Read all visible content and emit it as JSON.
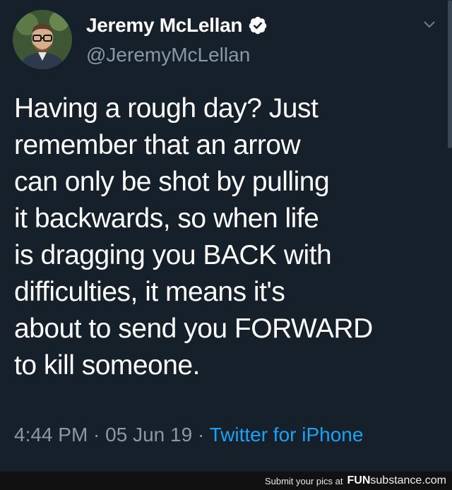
{
  "tweet": {
    "display_name": "Jeremy McLellan",
    "handle": "@JeremyMcLellan",
    "verified": true,
    "text": "Having a rough day? Just\nremember that an arrow\ncan only be shot by pulling\nit backwards, so when life\nis dragging you BACK with\ndifficulties, it means it's\nabout to send you FORWARD\nto kill someone.",
    "time": "4:44 PM",
    "sep1": " · ",
    "date": "05 Jun 19",
    "sep2": " · ",
    "source": "Twitter for iPhone"
  },
  "footer": {
    "credit": "Submit your pics at",
    "brand_fun": "FUN",
    "brand_rest": "substance.com"
  },
  "colors": {
    "background": "#15202b",
    "primary_text": "#ffffff",
    "secondary_text": "#8899a6",
    "link": "#1da1f2",
    "verified_badge": "#ffffff"
  }
}
